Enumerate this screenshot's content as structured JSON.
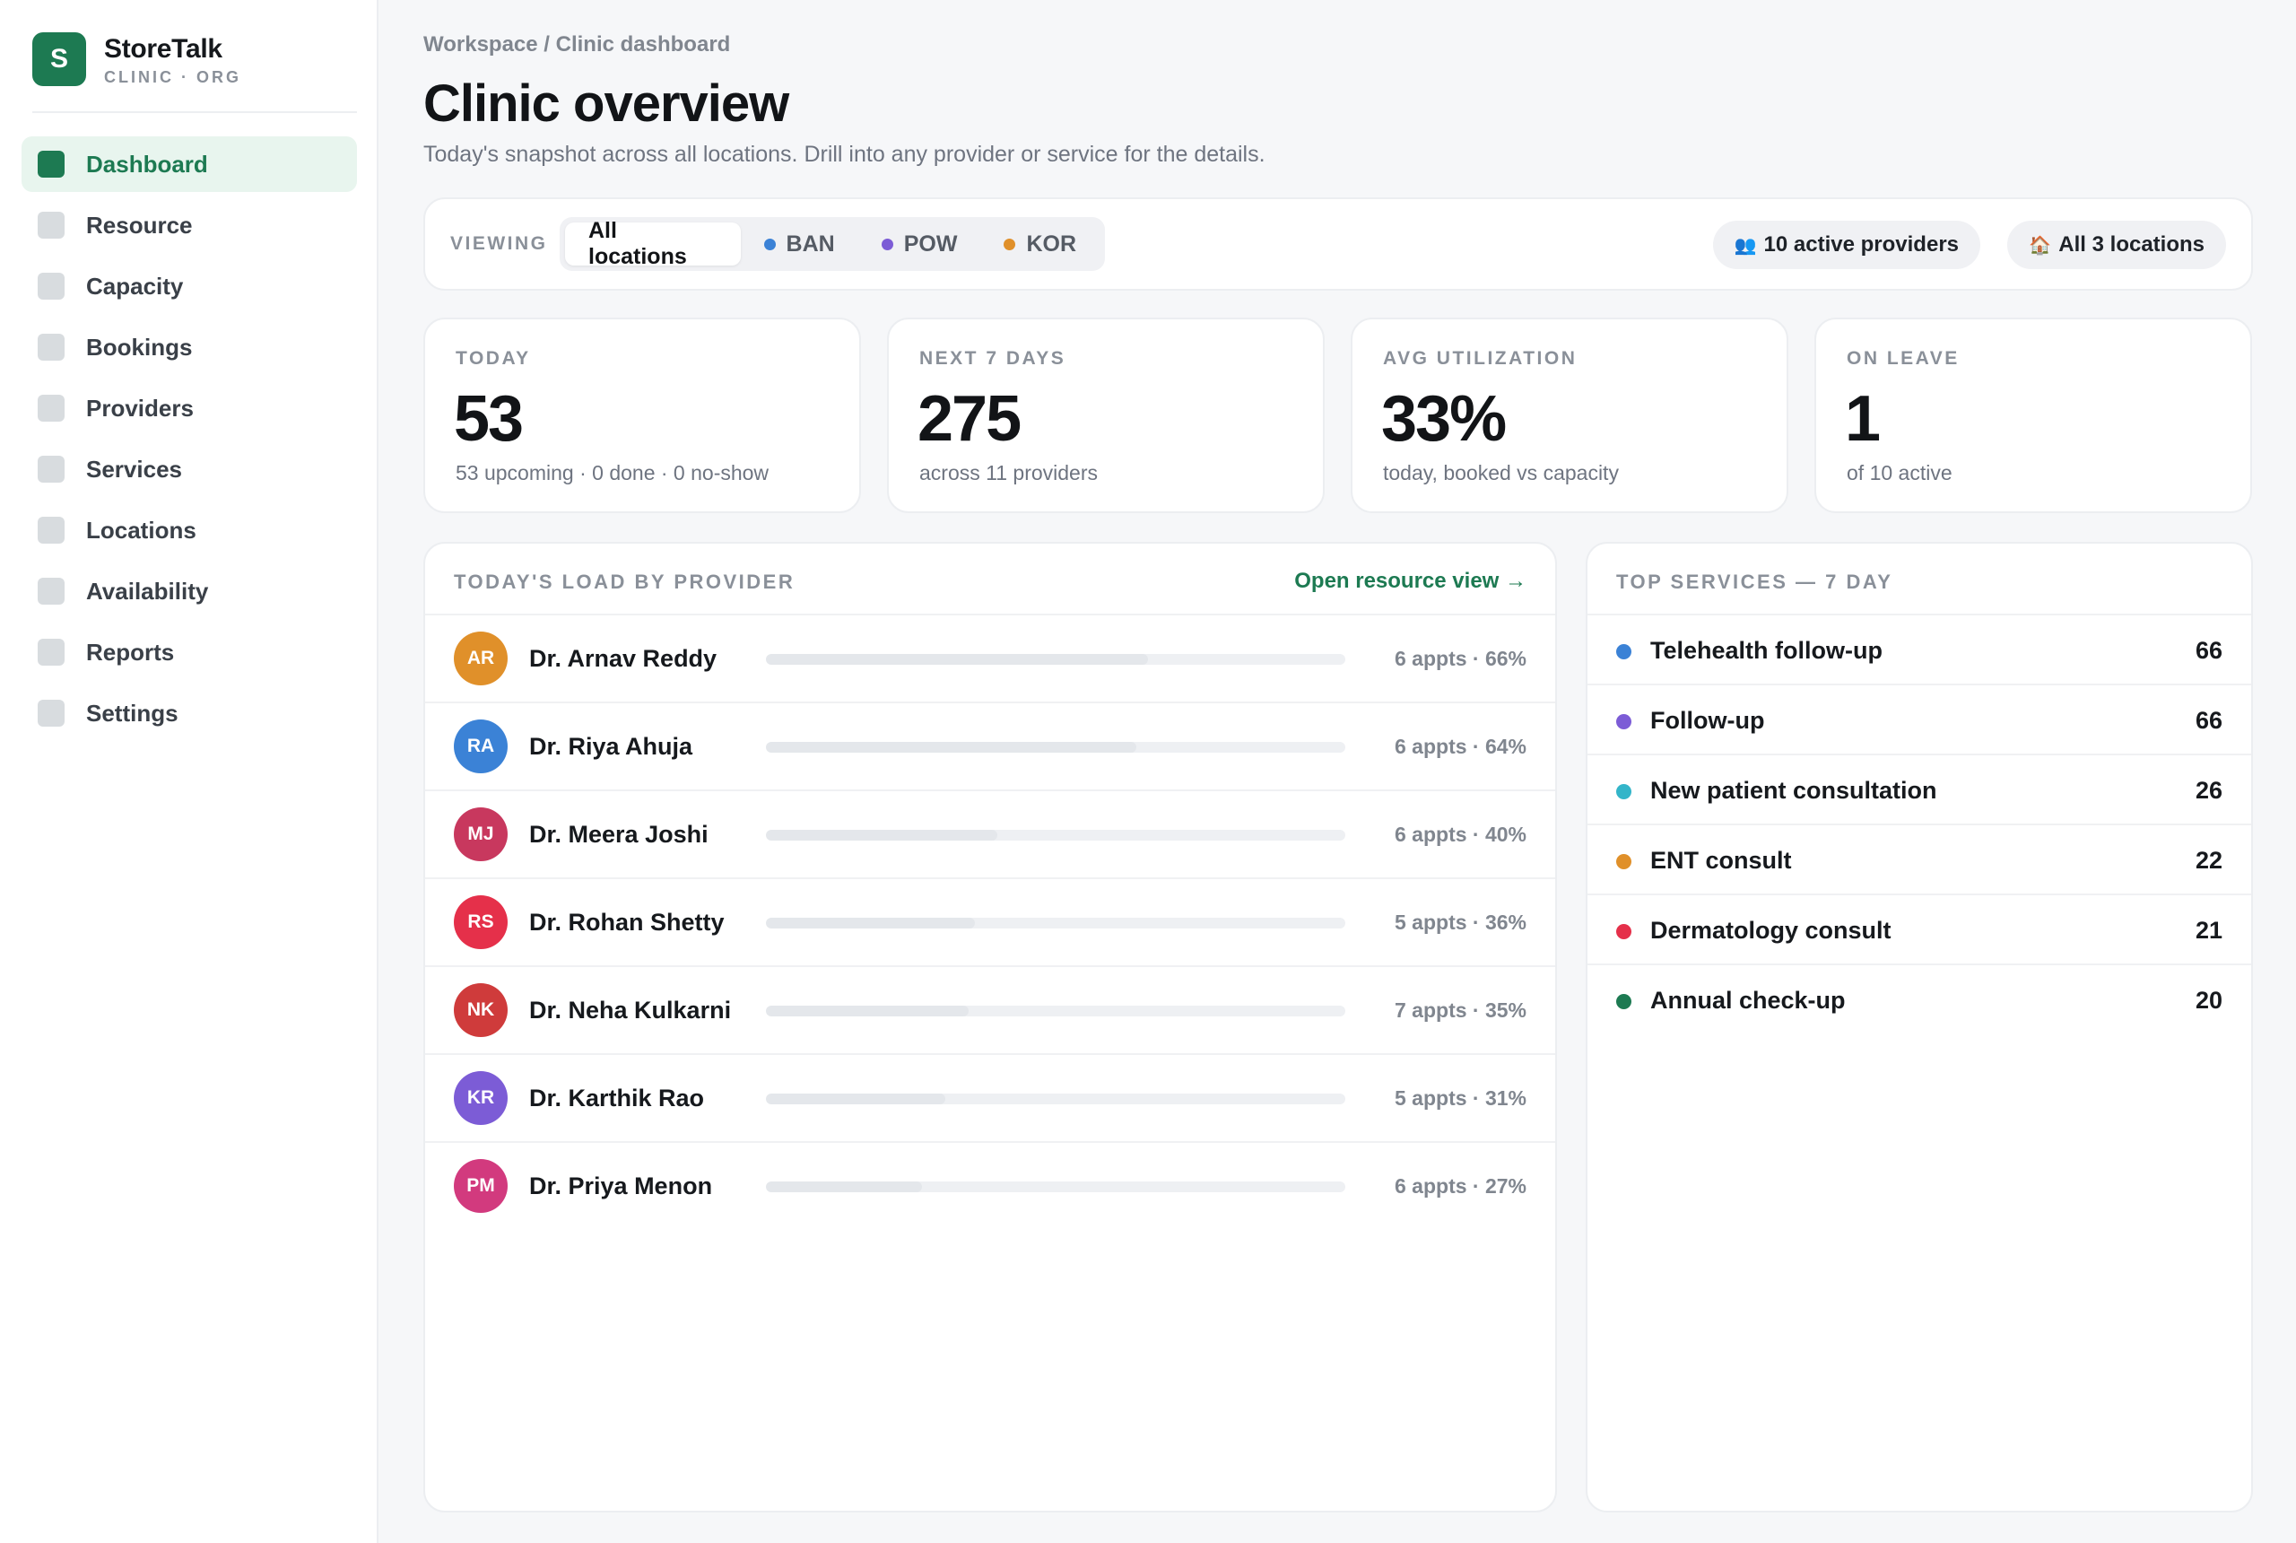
{
  "brand": {
    "logo_letter": "S",
    "name": "StoreTalk",
    "subtitle": "CLINIC · ORG",
    "color": "#1d7a52"
  },
  "sidebar": {
    "items": [
      {
        "label": "Dashboard",
        "active": true
      },
      {
        "label": "Resource"
      },
      {
        "label": "Capacity"
      },
      {
        "label": "Bookings"
      },
      {
        "label": "Providers"
      },
      {
        "label": "Services"
      },
      {
        "label": "Locations"
      },
      {
        "label": "Availability"
      },
      {
        "label": "Reports"
      },
      {
        "label": "Settings"
      }
    ]
  },
  "header": {
    "breadcrumb": "Workspace / Clinic dashboard",
    "title": "Clinic overview",
    "subtitle": "Today's snapshot across all locations. Drill into any provider or service for the details."
  },
  "filter": {
    "viewing_label": "VIEWING",
    "options": [
      {
        "label": "All locations",
        "active": true,
        "color": null
      },
      {
        "label": "BAN",
        "color": "#3b82d6"
      },
      {
        "label": "POW",
        "color": "#7c5cd6"
      },
      {
        "label": "KOR",
        "color": "#e0902a"
      }
    ],
    "providers_pill": {
      "icon": "👥",
      "label": "10 active providers"
    },
    "locations_pill": {
      "icon": "🏠",
      "label": "All 3 locations"
    }
  },
  "stats": [
    {
      "label": "TODAY",
      "value": "53",
      "sub": "53 upcoming · 0 done · 0 no-show"
    },
    {
      "label": "NEXT 7 DAYS",
      "value": "275",
      "sub": "across 11 providers"
    },
    {
      "label": "AVG UTILIZATION",
      "value": "33%",
      "sub": "today, booked vs capacity"
    },
    {
      "label": "ON LEAVE",
      "value": "1",
      "sub": "of 10 active"
    }
  ],
  "load": {
    "title": "TODAY'S LOAD BY PROVIDER",
    "link": "Open resource view →",
    "providers": [
      {
        "initials": "AR",
        "name": "Dr. Arnav Reddy",
        "meta": "6 appts · 66%",
        "util": 0.66,
        "color": "#e0902a"
      },
      {
        "initials": "RA",
        "name": "Dr. Riya Ahuja",
        "meta": "6 appts · 64%",
        "util": 0.64,
        "color": "#3b82d6"
      },
      {
        "initials": "MJ",
        "name": "Dr. Meera Joshi",
        "meta": "6 appts · 40%",
        "util": 0.4,
        "color": "#c8385e"
      },
      {
        "initials": "RS",
        "name": "Dr. Rohan Shetty",
        "meta": "5 appts · 36%",
        "util": 0.36,
        "color": "#e5304a"
      },
      {
        "initials": "NK",
        "name": "Dr. Neha Kulkarni",
        "meta": "7 appts · 35%",
        "util": 0.35,
        "color": "#cf3b3b"
      },
      {
        "initials": "KR",
        "name": "Dr. Karthik Rao",
        "meta": "5 appts · 31%",
        "util": 0.31,
        "color": "#7c5cd6"
      },
      {
        "initials": "PM",
        "name": "Dr. Priya Menon",
        "meta": "6 appts · 27%",
        "util": 0.27,
        "color": "#d23a7e"
      }
    ]
  },
  "services": {
    "title": "TOP SERVICES — 7 DAY",
    "items": [
      {
        "name": "Telehealth follow-up",
        "count": "66",
        "color": "#3b82d6"
      },
      {
        "name": "Follow-up",
        "count": "66",
        "color": "#7c5cd6"
      },
      {
        "name": "New patient consultation",
        "count": "26",
        "color": "#33b5c9"
      },
      {
        "name": "ENT consult",
        "count": "22",
        "color": "#e0902a"
      },
      {
        "name": "Dermatology consult",
        "count": "21",
        "color": "#e5304a"
      },
      {
        "name": "Annual check-up",
        "count": "20",
        "color": "#1d7a52"
      }
    ]
  }
}
